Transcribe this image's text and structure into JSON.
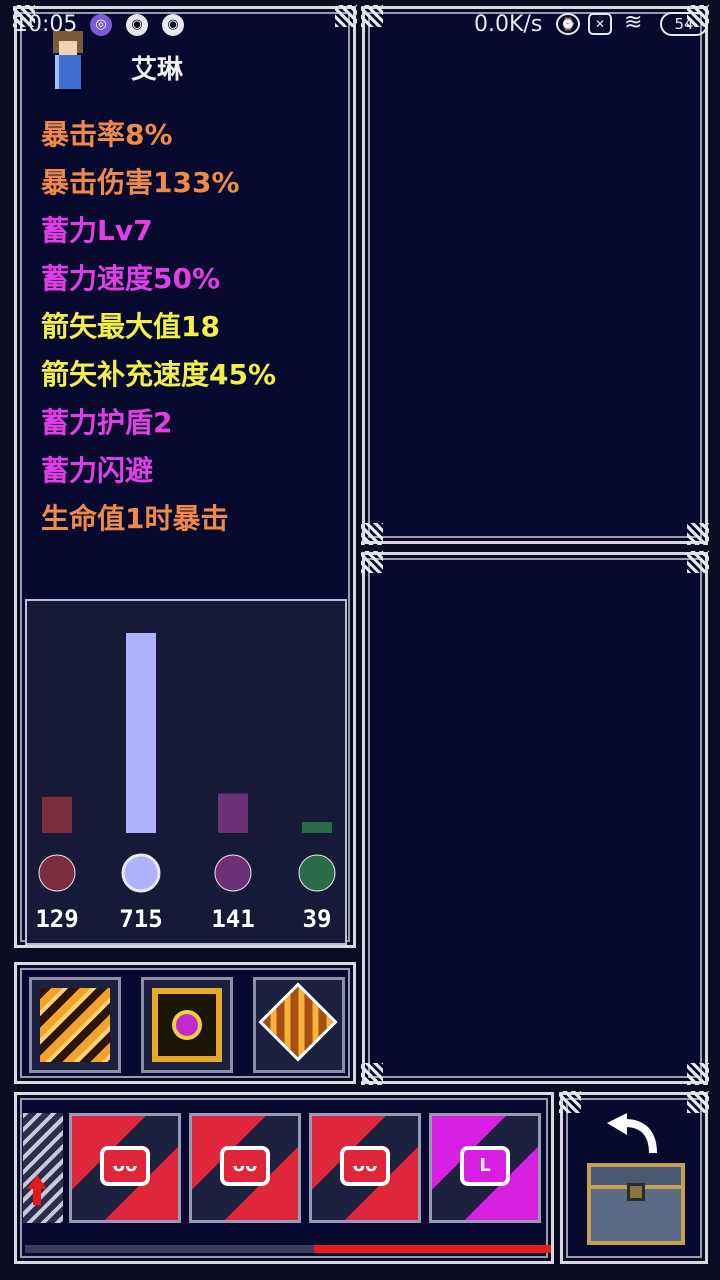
{
  "status_bar": {
    "time": "10:05",
    "net_speed": "0.0K/s",
    "battery": "54",
    "icons": [
      "app-icon",
      "eye-icon",
      "eye-icon",
      "alarm-icon",
      "sim-off-icon",
      "wifi-icon",
      "battery-icon"
    ]
  },
  "hero": {
    "name": "艾琳"
  },
  "stats": [
    {
      "text": "暴击率8%",
      "color": "#f08a4b"
    },
    {
      "text": "暴击伤害133%",
      "color": "#f08a4b"
    },
    {
      "text": "蓄力Lv7",
      "color": "#e23ee6"
    },
    {
      "text": "蓄力速度50%",
      "color": "#e23ee6"
    },
    {
      "text": "箭矢最大值18",
      "color": "#f2ef46"
    },
    {
      "text": "箭矢补充速度45%",
      "color": "#f2ef46"
    },
    {
      "text": "蓄力护盾2",
      "color": "#e23ee6"
    },
    {
      "text": "蓄力闪避",
      "color": "#e23ee6"
    },
    {
      "text": "生命值1时暴击",
      "color": "#f08a4b"
    }
  ],
  "chart_data": {
    "type": "bar",
    "categories": [
      "blood",
      "frost",
      "shadow",
      "poison"
    ],
    "values": [
      129,
      715,
      141,
      39
    ],
    "labels": [
      "129",
      "715",
      "141",
      "39"
    ],
    "colors": [
      "#7a2e3c",
      "#aeb2ff",
      "#6d3178",
      "#2b6b4a"
    ],
    "icons": [
      "blood-drop-icon",
      "snowflake-icon",
      "shadow-orb-icon",
      "poison-flask-icon"
    ],
    "ylim": [
      0,
      715
    ]
  },
  "items": [
    {
      "name": "striped-shield-icon"
    },
    {
      "name": "golden-eye-icon"
    },
    {
      "name": "cross-gem-icon"
    }
  ],
  "cards": [
    {
      "symbol": "ᴗᴗ",
      "color": "#e0263a"
    },
    {
      "symbol": "ᴗᴗ",
      "color": "#e0263a"
    },
    {
      "symbol": "ᴗᴗ",
      "color": "#e0263a"
    },
    {
      "symbol": "ᒪ",
      "color": "#d61fe0"
    }
  ],
  "draw_progress": 0.45,
  "colors": {
    "frame": "#d9d9e6",
    "panel_bg": "#070a2e",
    "accent_red": "#e61b1b"
  }
}
